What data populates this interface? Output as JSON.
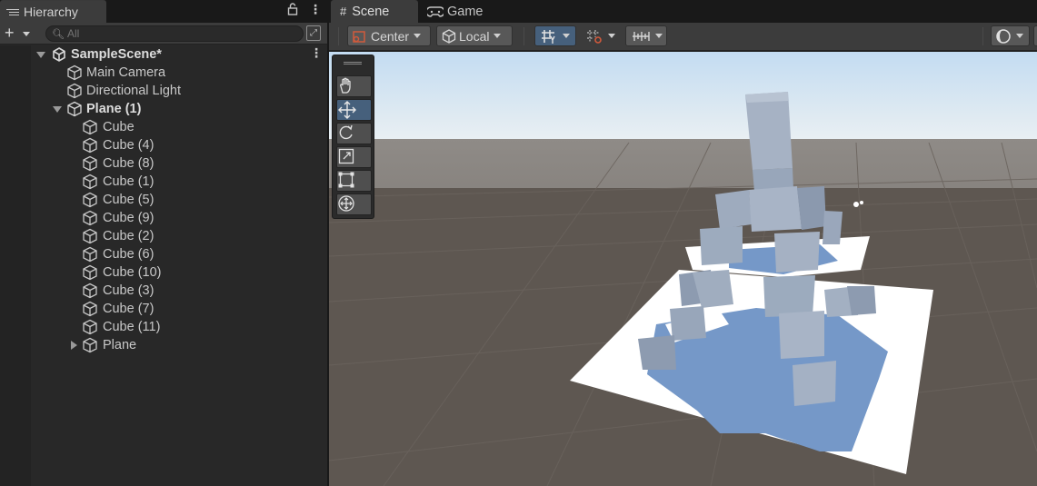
{
  "hierarchy": {
    "tab_title": "Hierarchy",
    "search_placeholder": "All",
    "scene_name": "SampleScene*",
    "items": [
      {
        "label": "Main Camera"
      },
      {
        "label": "Directional Light"
      },
      {
        "label": "Plane (1)"
      },
      {
        "label": "Cube"
      },
      {
        "label": "Cube (4)"
      },
      {
        "label": "Cube (8)"
      },
      {
        "label": "Cube (1)"
      },
      {
        "label": "Cube (5)"
      },
      {
        "label": "Cube (9)"
      },
      {
        "label": "Cube (2)"
      },
      {
        "label": "Cube (6)"
      },
      {
        "label": "Cube (10)"
      },
      {
        "label": "Cube (3)"
      },
      {
        "label": "Cube (7)"
      },
      {
        "label": "Cube (11)"
      },
      {
        "label": "Plane"
      }
    ]
  },
  "scene_view": {
    "tabs": [
      {
        "label": "Scene",
        "icon": "grid-icon"
      },
      {
        "label": "Game",
        "icon": "gamepad-icon"
      }
    ],
    "toolbar": {
      "pivot_mode": "Center",
      "pivot_rotation": "Local"
    },
    "tools": [
      "hand-tool",
      "move-tool",
      "rotate-tool",
      "scale-tool",
      "rect-tool",
      "transform-tool"
    ],
    "active_tool": "move-tool"
  },
  "colors": {
    "selection_blue": "#46607c",
    "panel_bg": "#282828",
    "ground": "#5e5751",
    "sky": "#c3dcf2"
  }
}
